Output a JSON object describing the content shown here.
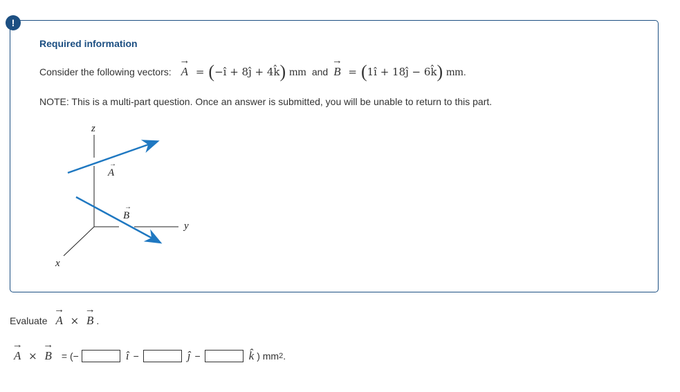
{
  "alert": {
    "icon": "exclamation-icon",
    "glyph": "!"
  },
  "info": {
    "title": "Required information",
    "consider_prefix": "Consider the following vectors:",
    "vector_A": {
      "name": "A",
      "expr": "−î + 8ĵ + 4k̂",
      "unit": "mm"
    },
    "and_label": "and",
    "vector_B": {
      "name": "B",
      "expr": "1î + 18ĵ − 6k̂",
      "unit": "mm"
    },
    "period": ".",
    "note": "NOTE: This is a multi-part question. Once an answer is submitted, you will be unable to return to this part."
  },
  "diagram": {
    "axis_z": "z",
    "axis_y": "y",
    "axis_x": "x",
    "label_A": "A",
    "label_B": "B",
    "vector_color": "#1f78c1"
  },
  "question": {
    "evaluate_label": "Evaluate",
    "expr_A": "A",
    "cross": "×",
    "expr_B": "B",
    "period": "."
  },
  "answer": {
    "lhs_A": "A",
    "cross": "×",
    "lhs_B": "B",
    "equals_open": "= (−",
    "unit_i": "î",
    "minus1": "−",
    "unit_j": "ĵ",
    "minus2": "−",
    "unit_k": "k̂",
    "close": ") mm",
    "exponent": "2",
    "end": ".",
    "inputs": [
      {
        "value": "",
        "placeholder": ""
      },
      {
        "value": "",
        "placeholder": ""
      },
      {
        "value": "",
        "placeholder": ""
      }
    ]
  }
}
